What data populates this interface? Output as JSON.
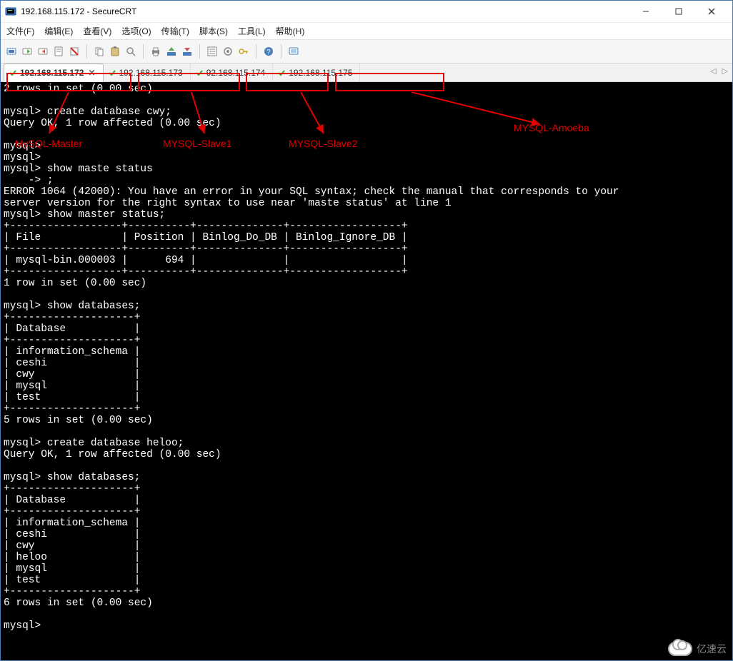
{
  "window": {
    "title": "192.168.115.172 - SecureCRT"
  },
  "menu": {
    "file": "文件(F)",
    "edit": "编辑(E)",
    "view": "查看(V)",
    "option": "选项(O)",
    "transfer": "传输(T)",
    "script": "脚本(S)",
    "tool": "工具(L)",
    "help": "帮助(H)"
  },
  "toolbar_icons": [
    "connect-icon",
    "quick-connect-icon",
    "reconnect-icon",
    "session-icon",
    "disconnect-icon",
    "copy-icon",
    "paste-icon",
    "find-icon",
    "print-icon",
    "upload-icon",
    "download-icon",
    "options-icon",
    "settings-icon",
    "key-icon",
    "help-icon",
    "screen-icon"
  ],
  "tabs": [
    {
      "label": "192.168.115.172",
      "active": true,
      "has_close": true
    },
    {
      "label": "192.168.115.173",
      "active": false,
      "has_close": false
    },
    {
      "label": "92.168.115.174",
      "active": false,
      "has_close": false
    },
    {
      "label": "192.168.115.175",
      "active": false,
      "has_close": false
    }
  ],
  "annotations": {
    "tab1": "MySQL-Master",
    "tab2": "MYSQL-Slave1",
    "tab3": "MYSQL-Slave2",
    "tab4": "MYSQL-Amoeba"
  },
  "colors": {
    "annotation": "#e30000",
    "terminal_bg": "#000000",
    "terminal_fg": "#ffffff"
  },
  "terminal_lines": [
    "2 rows in set (0.00 sec)",
    "",
    "mysql> create database cwy;",
    "Query OK, 1 row affected (0.00 sec)",
    "",
    "mysql>",
    "mysql>",
    "mysql> show maste status",
    "    -> ;",
    "ERROR 1064 (42000): You have an error in your SQL syntax; check the manual that corresponds to your",
    "server version for the right syntax to use near 'maste status' at line 1",
    "mysql> show master status;",
    "+------------------+----------+--------------+------------------+",
    "| File             | Position | Binlog_Do_DB | Binlog_Ignore_DB |",
    "+------------------+----------+--------------+------------------+",
    "| mysql-bin.000003 |      694 |              |                  |",
    "+------------------+----------+--------------+------------------+",
    "1 row in set (0.00 sec)",
    "",
    "mysql> show databases;",
    "+--------------------+",
    "| Database           |",
    "+--------------------+",
    "| information_schema |",
    "| ceshi              |",
    "| cwy                |",
    "| mysql              |",
    "| test               |",
    "+--------------------+",
    "5 rows in set (0.00 sec)",
    "",
    "mysql> create database heloo;",
    "Query OK, 1 row affected (0.00 sec)",
    "",
    "mysql> show databases;",
    "+--------------------+",
    "| Database           |",
    "+--------------------+",
    "| information_schema |",
    "| ceshi              |",
    "| cwy                |",
    "| heloo              |",
    "| mysql              |",
    "| test               |",
    "+--------------------+",
    "6 rows in set (0.00 sec)",
    "",
    "mysql>"
  ],
  "watermark": "亿速云"
}
